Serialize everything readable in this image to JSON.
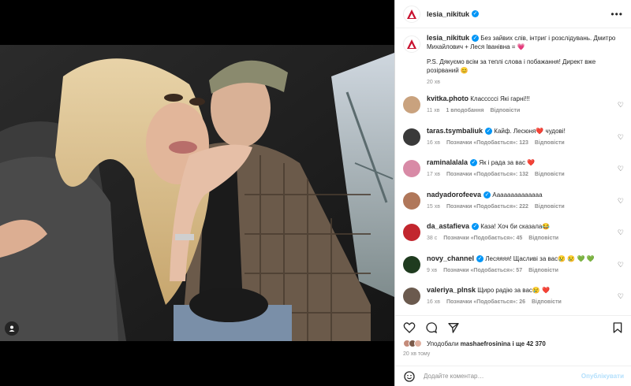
{
  "post": {
    "author": "lesia_nikituk",
    "caption_line1": "Без зайвих слів, інтриг і розслідувань. Дмитро Михайлович + Леся Іванівна = 💗",
    "caption_line2": "P.S. Дякуємо всім за теплі слова і побажання! Директ вже розірваний 😊",
    "caption_time": "20 хв"
  },
  "comments": [
    {
      "user": "kvitka.photo",
      "verified": false,
      "text": "Класссссі Які гарні!!!",
      "time": "11 хв",
      "likes": "1 вподобання",
      "reply": "Відповісти",
      "avatar_color": "#c9a27e"
    },
    {
      "user": "taras.tsymbaliuk",
      "verified": true,
      "text": "Кайф. Лесюня❤️ чудові!",
      "time": "16 хв",
      "likes": "Позначки «Подобається»: 123",
      "reply": "Відповісти",
      "avatar_color": "#3a3a3a"
    },
    {
      "user": "raminalalala",
      "verified": true,
      "text": "Як і рада за вас ❤️",
      "time": "17 хв",
      "likes": "Позначки «Подобається»: 132",
      "reply": "Відповісти",
      "avatar_color": "#d88aa6"
    },
    {
      "user": "nadyadorofeeva",
      "verified": true,
      "text": "Аааааааааааааа",
      "time": "15 хв",
      "likes": "Позначки «Подобається»: 222",
      "reply": "Відповісти",
      "avatar_color": "#b0775a"
    },
    {
      "user": "da_astafieva",
      "verified": true,
      "text": "Каза! Хоч би сказала😂",
      "time": "38 с",
      "likes": "Позначки «Подобається»: 45",
      "reply": "Відповісти",
      "avatar_color": "#c2262e"
    },
    {
      "user": "novy_channel",
      "verified": true,
      "text": "Лесяяяя! Щасливі за вас😢 😢 💚 💚",
      "time": "9 хв",
      "likes": "Позначки «Подобається»: 57",
      "reply": "Відповісти",
      "avatar_color": "#1f3b1f"
    },
    {
      "user": "valeriya_plnsk",
      "verified": false,
      "text": "Щиро радію за вас😢 ❤️",
      "time": "16 хв",
      "likes": "Позначки «Подобається»: 26",
      "reply": "Відповісти",
      "avatar_color": "#6b5a4e"
    }
  ],
  "likes": {
    "prefix": "Уподобали",
    "user": "mashaefrosinina",
    "suffix": "і ще 42 370"
  },
  "post_time": "20 хв тому",
  "comment_box": {
    "placeholder": "Додайте коментар…",
    "publish": "Опублікувати"
  },
  "colors": {
    "accent": "#0095f6",
    "heart_red": "#ed4956"
  }
}
